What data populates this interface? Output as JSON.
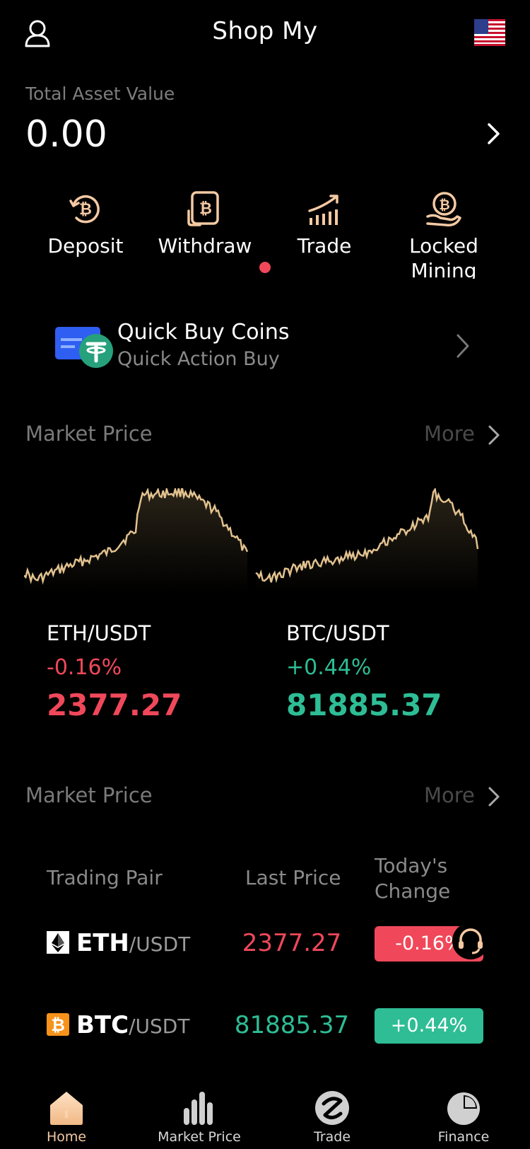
{
  "header": {
    "title": "Shop My",
    "user_icon": "user-icon",
    "flag_icon": "us-flag-icon"
  },
  "asset": {
    "label": "Total Asset Value",
    "value": "0.00"
  },
  "actions": [
    {
      "label": "Deposit",
      "icon": "deposit-bitcoin-icon"
    },
    {
      "label": "Withdraw",
      "icon": "withdraw-bitcoin-icon"
    },
    {
      "label": "Trade",
      "icon": "trade-chart-icon"
    },
    {
      "label": "Locked Mining",
      "icon": "locked-mining-icon"
    }
  ],
  "quick_buy": {
    "title": "Quick Buy Coins",
    "subtitle": "Quick Action Buy"
  },
  "market_section_1": {
    "title": "Market Price",
    "more": "More"
  },
  "mini_charts": [
    {
      "pair": "ETH/USDT",
      "change": "-0.16%",
      "price": "2377.27",
      "trend": "down"
    },
    {
      "pair": "BTC/USDT",
      "change": "+0.44%",
      "price": "81885.37",
      "trend": "up"
    }
  ],
  "market_section_2": {
    "title": "Market Price",
    "more": "More"
  },
  "table": {
    "headers": {
      "pair": "Trading Pair",
      "last": "Last Price",
      "change_line1": "Today's",
      "change_line2": "Change"
    },
    "rows": [
      {
        "base": "ETH",
        "quote": "/USDT",
        "price": "2377.27",
        "change": "-0.16%",
        "trend": "down"
      },
      {
        "base": "BTC",
        "quote": "/USDT",
        "price": "81885.37",
        "change": "+0.44%",
        "trend": "up"
      }
    ]
  },
  "bottom_nav": [
    {
      "label": "Home",
      "active": true
    },
    {
      "label": "Market Price",
      "active": false
    },
    {
      "label": "Trade",
      "active": false
    },
    {
      "label": "Finance",
      "active": false
    }
  ],
  "colors": {
    "up": "#2ebd95",
    "down": "#f0485a",
    "accent": "#f4c9a3",
    "chart_line": "#e2c28f"
  }
}
